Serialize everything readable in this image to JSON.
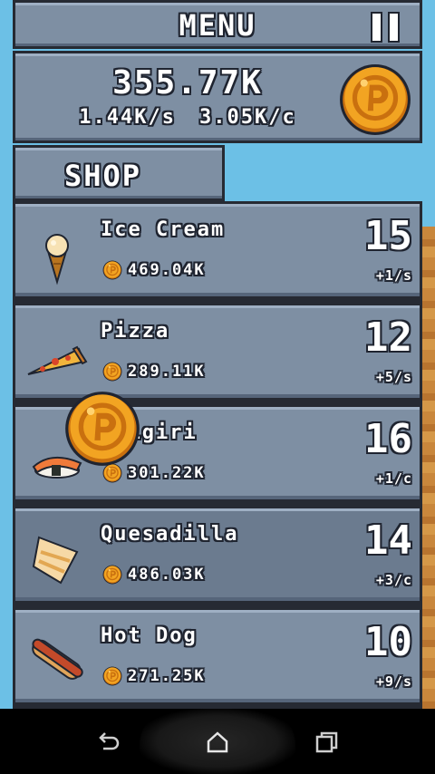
{
  "header": {
    "title": "MENU",
    "pause_icon": "pause-icon"
  },
  "stats": {
    "money": "355.77K",
    "per_second": "1.44K/s",
    "per_click": "3.05K/c",
    "coin_icon": "coin-icon"
  },
  "shop": {
    "title": "SHOP",
    "items": [
      {
        "name": "Ice Cream",
        "cost": "469.04K",
        "count": "15",
        "rate": "+1/s",
        "icon": "ice-cream-icon"
      },
      {
        "name": "Pizza",
        "cost": "289.11K",
        "count": "12",
        "rate": "+5/s",
        "icon": "pizza-icon"
      },
      {
        "name": "Onigiri",
        "cost": "301.22K",
        "count": "16",
        "rate": "+1/c",
        "icon": "sushi-icon"
      },
      {
        "name": "Quesadilla",
        "cost": "486.03K",
        "count": "14",
        "rate": "+3/c",
        "icon": "quesadilla-icon"
      },
      {
        "name": "Hot Dog",
        "cost": "271.25K",
        "count": "10",
        "rate": "+9/s",
        "icon": "hot-dog-icon"
      }
    ]
  },
  "colors": {
    "panel": "#7e8fa3",
    "outline": "#262a33",
    "sky": "#6cc0e6",
    "coin": "#f2a422"
  },
  "navbar": {
    "back_icon": "back-icon",
    "home_icon": "home-icon",
    "recents_icon": "recents-icon"
  }
}
